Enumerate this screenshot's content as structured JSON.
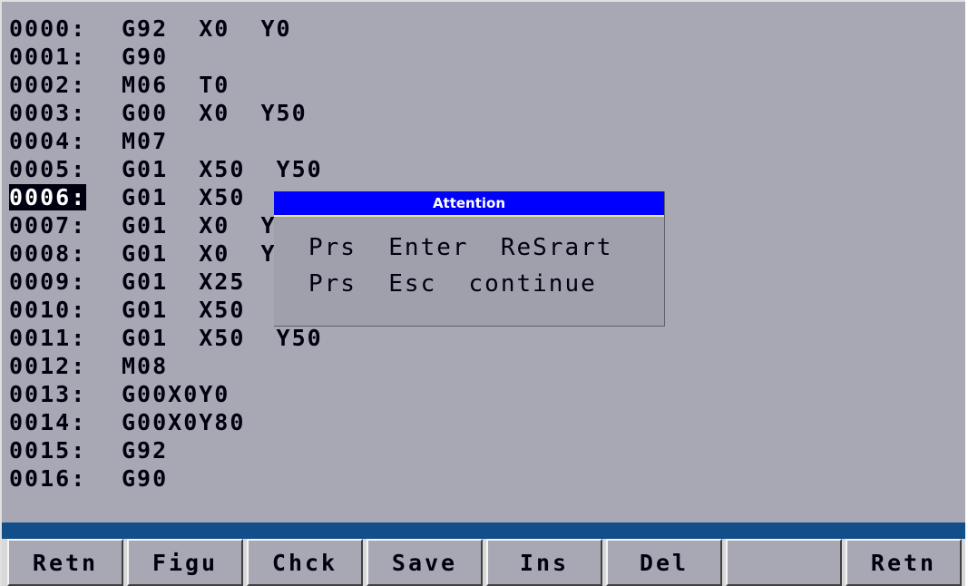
{
  "program": {
    "lines": [
      {
        "n": "0000:",
        "code": "G92  X0  Y0"
      },
      {
        "n": "0001:",
        "code": "G90"
      },
      {
        "n": "0002:",
        "code": "M06  T0"
      },
      {
        "n": "0003:",
        "code": "G00  X0  Y50"
      },
      {
        "n": "0004:",
        "code": "M07"
      },
      {
        "n": "0005:",
        "code": "G01  X50  Y50"
      },
      {
        "n": "0006:",
        "code": "G01  X50"
      },
      {
        "n": "0007:",
        "code": "G01  X0  Y"
      },
      {
        "n": "0008:",
        "code": "G01  X0  Y"
      },
      {
        "n": "0009:",
        "code": "G01  X25"
      },
      {
        "n": "0010:",
        "code": "G01  X50"
      },
      {
        "n": "0011:",
        "code": "G01  X50  Y50"
      },
      {
        "n": "0012:",
        "code": "M08"
      },
      {
        "n": "0013:",
        "code": "G00X0Y0"
      },
      {
        "n": "0014:",
        "code": "G00X0Y80"
      },
      {
        "n": "0015:",
        "code": "G92"
      },
      {
        "n": "0016:",
        "code": "G90"
      }
    ],
    "selected_index": 6
  },
  "dialog": {
    "title": "Attention",
    "line1": "Prs  Enter  ReSrart",
    "line2": "Prs  Esc  continue"
  },
  "softkeys": [
    "Retn",
    "Figu",
    "Chck",
    "Save",
    "Ins",
    "Del",
    "",
    "Retn"
  ],
  "colors": {
    "screen_bg": "#a8a8b4",
    "dialog_title_bg": "#0000ff",
    "statusbar": "#114e8a"
  }
}
